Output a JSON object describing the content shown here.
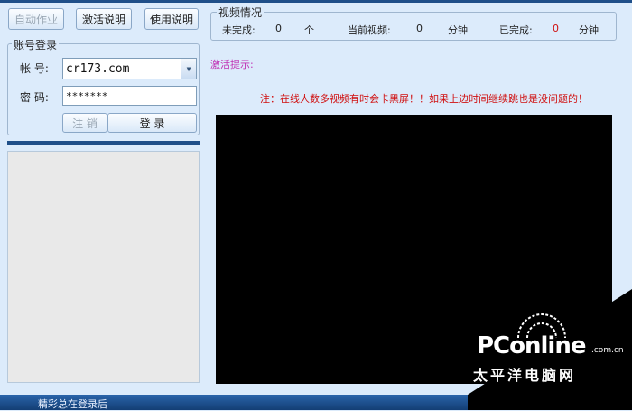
{
  "toolbar": {
    "auto_homework": "自动作业",
    "activation_help": "激活说明",
    "usage_help": "使用说明"
  },
  "login": {
    "group_title": "账号登录",
    "account_label": "帐  号:",
    "account_value": "cr173.com",
    "password_label": "密  码:",
    "password_value": "*******",
    "logout_label": "注 销",
    "login_label": "登 录"
  },
  "video_status": {
    "group_title": "视频情况",
    "unfinished_label": "未完成:",
    "unfinished_value": "0",
    "unfinished_unit": "个",
    "current_label": "当前视频:",
    "current_value": "0",
    "current_unit": "分钟",
    "finished_label": "已完成:",
    "finished_value": "0",
    "finished_unit": "分钟"
  },
  "activation_tip": "激活提示:",
  "warning": "注：在线人数多视频有时会卡黑屏！！如果上边时间继续跳也是没问题的！",
  "status_bar": "精彩总在登录后",
  "watermark": {
    "brand": "PConline",
    "domain": ".com.cn",
    "cn_name": "太平洋电脑网"
  },
  "colors": {
    "background": "#dcebfb",
    "accent": "#1f4f89",
    "warning": "#d01010",
    "tip": "#c02fb4"
  }
}
